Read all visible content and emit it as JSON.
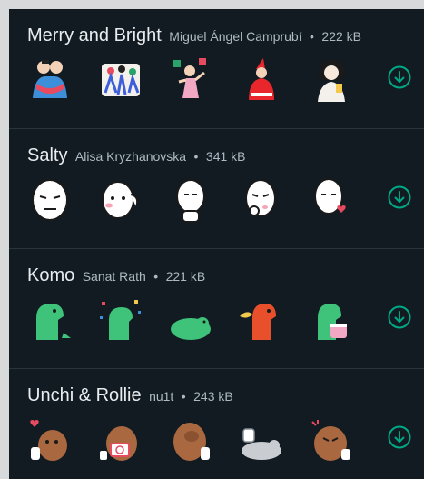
{
  "colors": {
    "background": "#121b22",
    "accent": "#00a884",
    "title": "#e9edef",
    "meta": "#aebac1"
  },
  "packs": [
    {
      "name": "Merry and Bright",
      "author": "Miguel Ángel Camprubí",
      "separator": "•",
      "size": "222 kB",
      "stickers": [
        "hugging-couple-sticker",
        "dancing-crowd-sticker",
        "party-girl-sticker",
        "red-santa-sticker",
        "girl-with-drink-sticker"
      ],
      "download_icon": "download-icon"
    },
    {
      "name": "Salty",
      "author": "Alisa Kryzhanovska",
      "separator": "•",
      "size": "341 kB",
      "stickers": [
        "white-face-sticker",
        "face-waving-sticker",
        "face-thumbs-sticker",
        "face-thinking-sticker",
        "face-heart-sticker"
      ],
      "download_icon": "download-icon"
    },
    {
      "name": "Komo",
      "author": "Sanat Rath",
      "separator": "•",
      "size": "221 kB",
      "stickers": [
        "green-dino-sticker",
        "dino-confetti-sticker",
        "dino-lying-sticker",
        "red-dino-fire-sticker",
        "dino-cake-sticker"
      ],
      "download_icon": "download-icon"
    },
    {
      "name": "Unchi & Rollie",
      "author": "nu1t",
      "separator": "•",
      "size": "243 kB",
      "stickers": [
        "brown-bear-hearts-sticker",
        "bear-sign-sticker",
        "bear-facepalm-sticker",
        "grey-cat-lying-sticker",
        "bear-angry-sticker"
      ],
      "download_icon": "download-icon"
    }
  ]
}
